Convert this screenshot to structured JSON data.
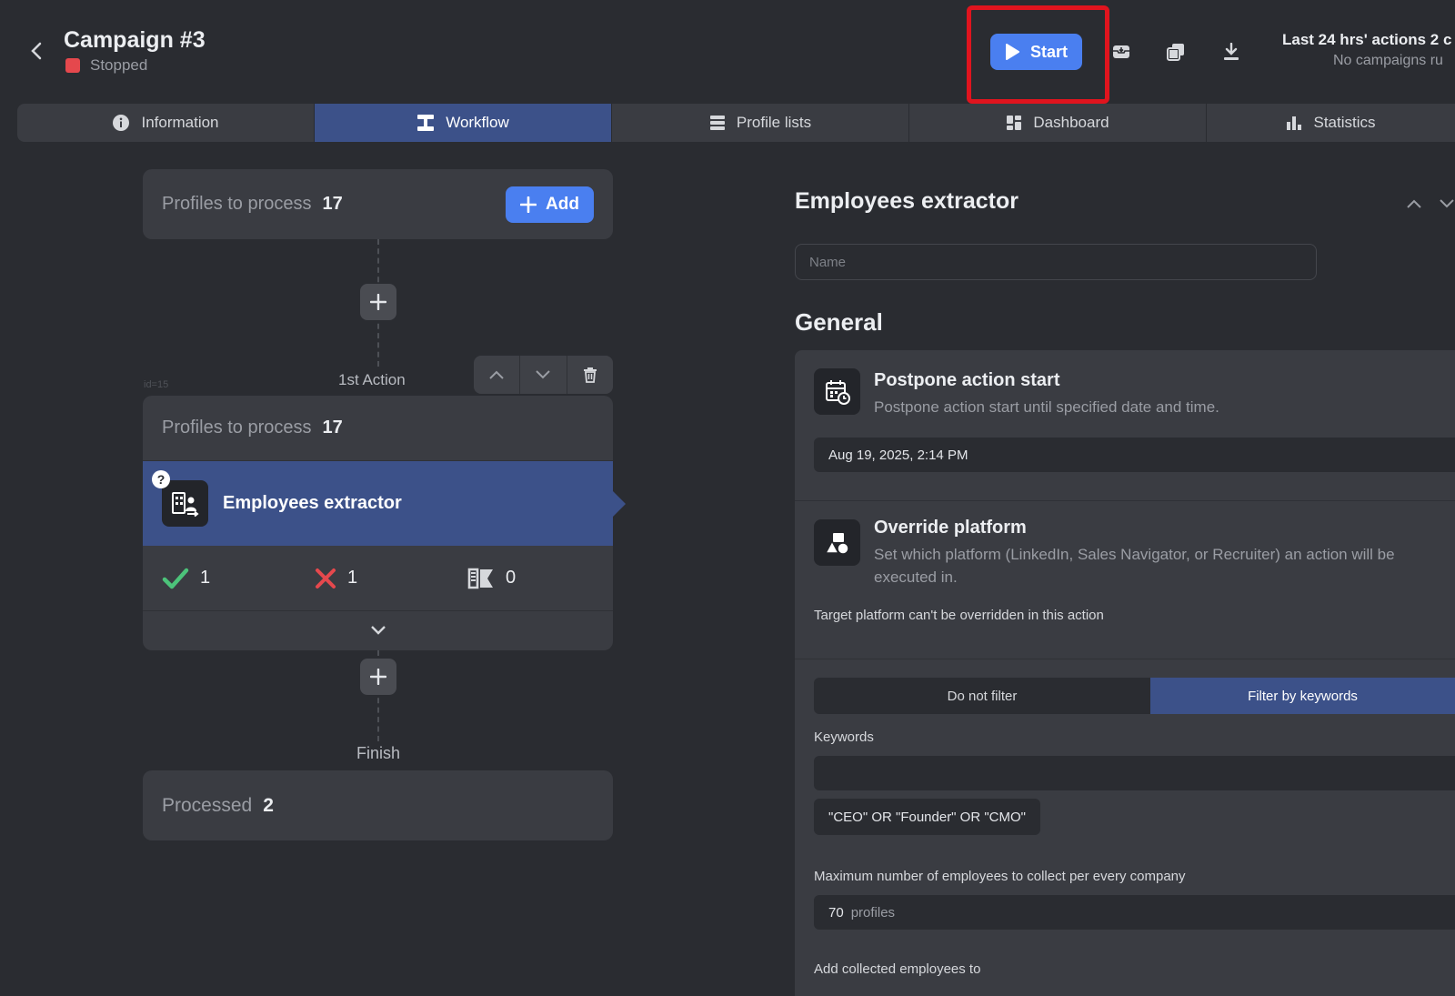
{
  "header": {
    "title": "Campaign #3",
    "status": "Stopped",
    "status_color": "#e5484d",
    "start_label": "Start",
    "info_line1": "Last 24 hrs' actions 2 c",
    "info_line2": "No campaigns ru"
  },
  "tabs": [
    {
      "label": "Information",
      "icon": "info-icon"
    },
    {
      "label": "Workflow",
      "icon": "workflow-icon"
    },
    {
      "label": "Profile lists",
      "icon": "list-icon"
    },
    {
      "label": "Dashboard",
      "icon": "dashboard-icon"
    },
    {
      "label": "Statistics",
      "icon": "bar-chart-icon"
    }
  ],
  "workflow": {
    "start": {
      "label": "Profiles to process",
      "count": "17",
      "add_label": "Add"
    },
    "id_label": "id=15",
    "action_label": "1st Action",
    "action": {
      "profiles_label": "Profiles to process",
      "profiles_count": "17",
      "help": "?",
      "name": "Employees extractor",
      "success": "1",
      "failed": "1",
      "skipped": "0"
    },
    "finish_label": "Finish",
    "processed": {
      "label": "Processed",
      "count": "2"
    }
  },
  "right_panel": {
    "title": "Employees extractor",
    "name_placeholder": "Name",
    "general_label": "General",
    "postpone": {
      "title": "Postpone action start",
      "desc": "Postpone action start until specified date and time.",
      "date": "Aug 19, 2025, 2:14 PM"
    },
    "override": {
      "title": "Override platform",
      "desc": "Set which platform (LinkedIn, Sales Navigator, or Recruiter) an action will be executed in.",
      "note": "Target platform can't be overridden in this action"
    },
    "filter": {
      "option1": "Do not filter",
      "option2": "Filter by keywords",
      "keywords_label": "Keywords",
      "keywords_value": "",
      "keyword_chip": "\"CEO\" OR \"Founder\" OR \"CMO\"",
      "max_label": "Maximum number of employees to collect per every company",
      "max_value": "70",
      "max_unit": "profiles",
      "add_to_label": "Add collected employees to"
    }
  }
}
